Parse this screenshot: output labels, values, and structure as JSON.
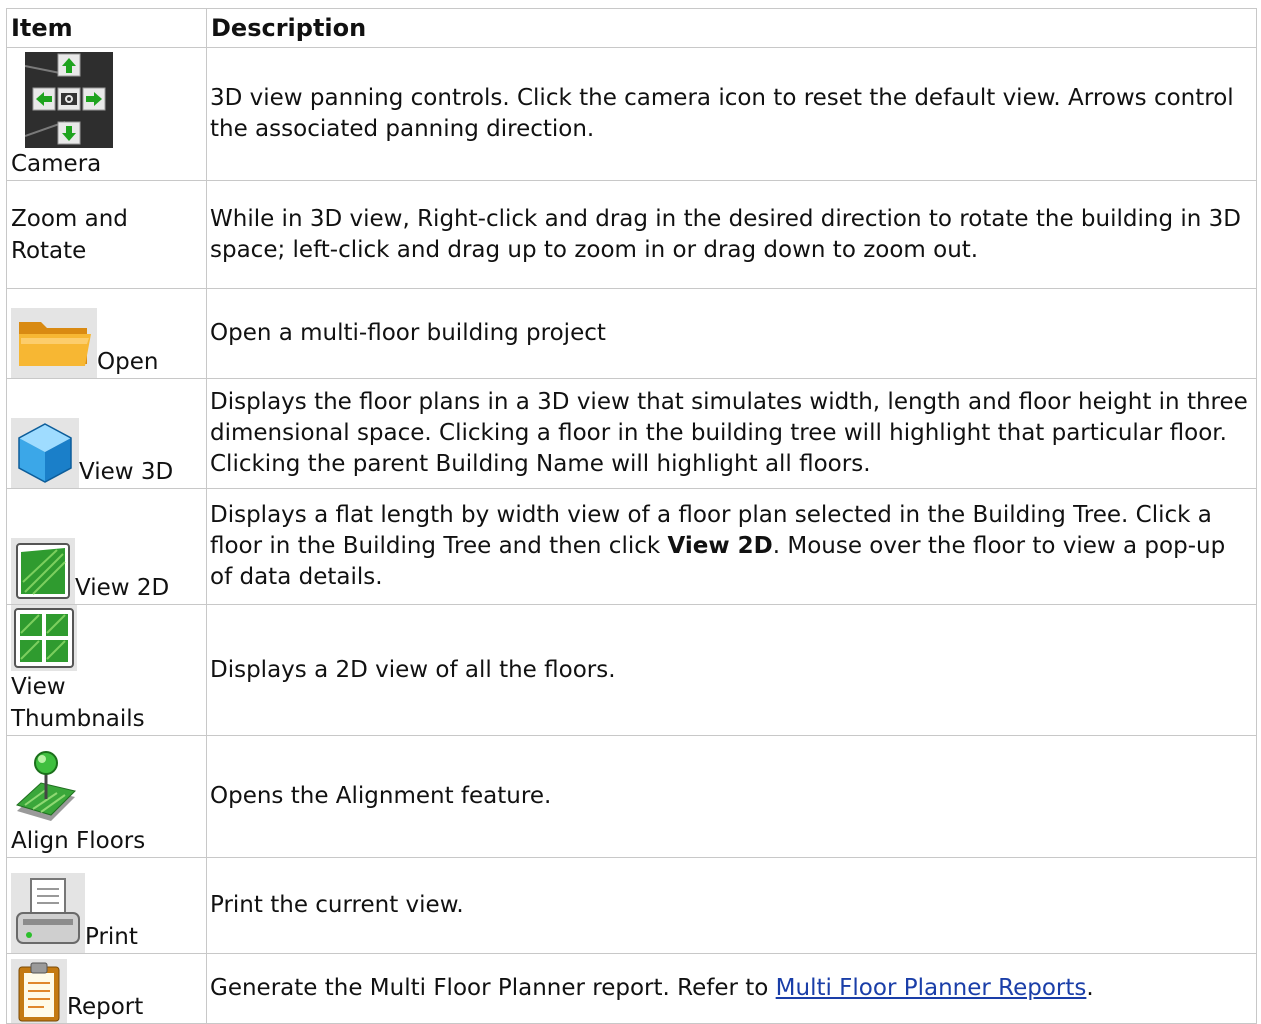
{
  "header": {
    "item": "Item",
    "description": "Description"
  },
  "rows": [
    {
      "label": "Camera",
      "icon": "camera-pan-control-icon",
      "desc": "3D view panning controls. Click the camera icon to reset the default view. Arrows control the associated panning direction."
    },
    {
      "label": "Zoom and Rotate",
      "icon": "",
      "desc": "While in 3D view, Right-click and drag in the desired direction to rotate the building in 3D space; left-click and drag up to zoom in or drag down to zoom out."
    },
    {
      "label": "Open",
      "icon": "folder-icon",
      "desc": "Open a multi-floor building project"
    },
    {
      "label": "View 3D",
      "icon": "cube-icon",
      "desc": "Displays the floor plans in a 3D view that simulates width, length and floor height in three dimensional space. Clicking a floor in the building tree will highlight that particular floor. Clicking the parent Building Name will highlight all floors."
    },
    {
      "label": "View 2D",
      "icon": "floor-plan-icon",
      "desc_a": "Displays a flat length by width view of a floor plan selected in the Building Tree. Click a floor in the Building Tree and then click ",
      "desc_bold": "View 2D",
      "desc_b": ". Mouse over the floor to view a pop-up of data details."
    },
    {
      "label": "View Thumbnails",
      "icon": "thumbnails-grid-icon",
      "desc": "Displays a 2D view of all the floors."
    },
    {
      "label": "Align Floors",
      "icon": "align-pin-icon",
      "desc": "Opens the Alignment feature."
    },
    {
      "label": "Print",
      "icon": "printer-icon",
      "desc": "Print the current view."
    },
    {
      "label": "Report",
      "icon": "clipboard-icon",
      "desc_a": "Generate the Multi Floor Planner report. Refer to ",
      "link": "Multi Floor Planner Reports",
      "desc_b": "."
    }
  ]
}
